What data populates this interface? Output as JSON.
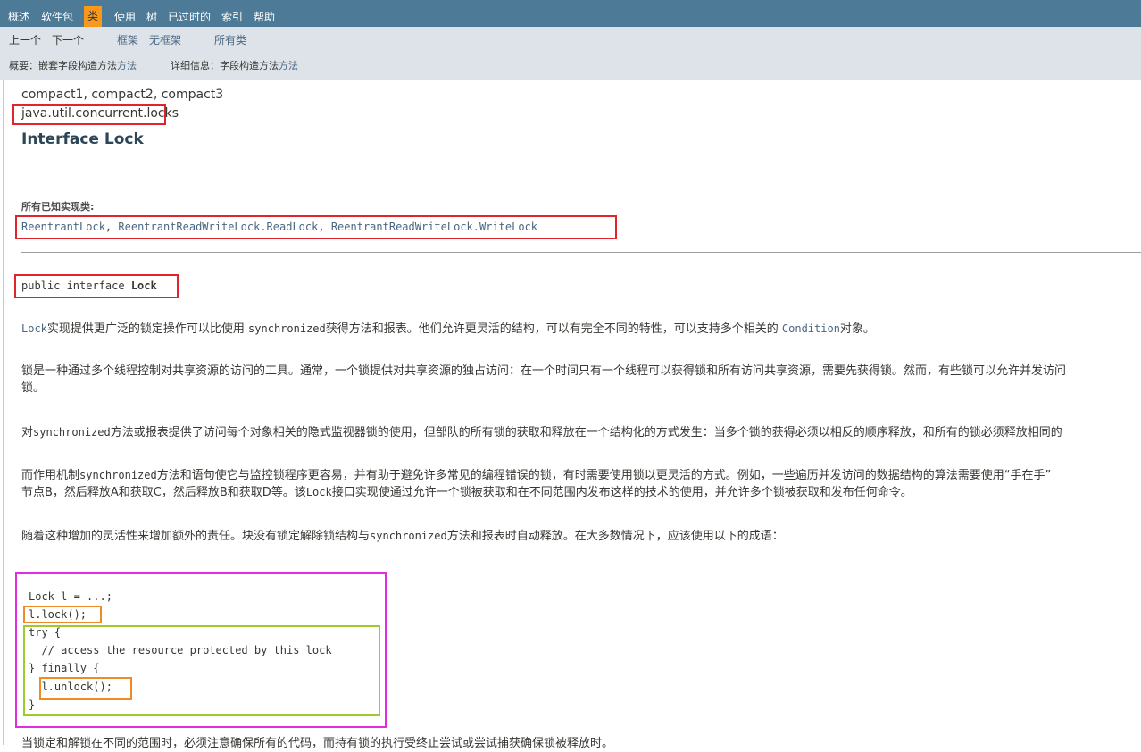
{
  "topnav": {
    "items": [
      "概述",
      "软件包",
      "类",
      "使用",
      "树",
      "已过时的",
      "索引",
      "帮助"
    ],
    "active": "类"
  },
  "subnav": {
    "prev": "上一个",
    "next": "下一个",
    "frames": "框架",
    "no_frames": "无框架",
    "all_classes": "所有类",
    "summary_label": "概要：",
    "summary_links": [
      "嵌套",
      "字段",
      "构造",
      "方法"
    ],
    "summary_tail": "方法",
    "detail_label": "详细信息：",
    "detail_links": [
      "字段",
      "构造",
      "方法"
    ],
    "detail_tail": "方法"
  },
  "content": {
    "profiles": "compact1, compact2, compact3",
    "package": "java.util.concurrent.locks",
    "title": "Interface Lock",
    "known_impl_label": "所有已知实现类:",
    "known_impls": [
      "ReentrantLock",
      "ReentrantReadWriteLock.ReadLock",
      "ReentrantReadWriteLock.WriteLock"
    ],
    "separator": ",",
    "signature_prefix": "public interface ",
    "signature_name": "Lock",
    "p1": {
      "a": "Lock",
      "b": "实现提供更广泛的锁定操作可以比使用 ",
      "c": "synchronized",
      "d": "获得方法和报表。他们允许更灵活的结构，可以有完全不同的特性，可以支持多个相关的 ",
      "e": "Condition",
      "f": "对象。"
    },
    "p2_line1": "锁是一种通过多个线程控制对共享资源的访问的工具。通常，一个锁提供对共享资源的独占访问：在一个时间只有一个线程可以获得锁和所有访问共享资源，需要先获得锁。然而，有些锁可以允许并发访问",
    "p2_line2": "锁。",
    "p3": {
      "a": "对",
      "b": "synchronized",
      "c": "方法或报表提供了访问每个对象相关的隐式监视器锁的使用，但部队的所有锁的获取和释放在一个结构化的方式发生：当多个锁的获得必须以相反的顺序释放，和所有的锁必须释放相同的"
    },
    "p4": {
      "a": "而作用机制",
      "b": "synchronized",
      "c": "方法和语句使它与监控锁程序更容易，并有助于避免许多常见的编程错误的锁，有时需要使用锁以更灵活的方式。例如，一些遍历并发访问的数据结构的算法需要使用“手在手”",
      "d": "节点B，然后释放A和获取C，然后释放B和获取D等。该",
      "e": "Lock",
      "f": "接口实现使通过允许一个锁被获取和在不同范围内发布这样的技术的使用，并允许多个锁被获取和发布任何命令。"
    },
    "p5": {
      "a": "随着这种增加的灵活性来增加额外的责任。块没有锁定解除锁结构与",
      "b": "synchronized",
      "c": "方法和报表时自动释放。在大多数情况下，应该使用以下的成语："
    },
    "code": [
      "Lock l = ...;",
      "l.lock();",
      "try {",
      "  // access the resource protected by this lock",
      "} finally {",
      "  l.unlock();",
      "}"
    ],
    "p6_partial": "当锁定和解锁在不同的范围时，必须注意确保所有的代码，而持有锁的执行受终止尝试或尝试捕获确保锁被释放时。"
  }
}
